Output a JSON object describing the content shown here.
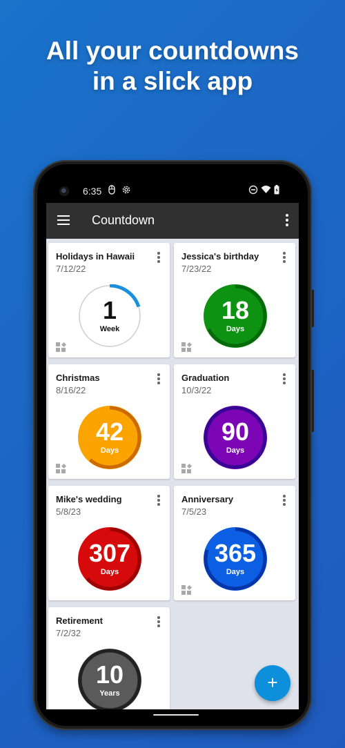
{
  "headline": {
    "line1": "All your countdowns",
    "line2": "in a slick app"
  },
  "statusbar": {
    "time": "6:35",
    "icons": [
      "lens-icon",
      "settings-icon",
      "do-not-disturb-icon",
      "wifi-icon",
      "battery-charging-icon"
    ]
  },
  "appbar": {
    "title": "Countdown",
    "menu_icon": "hamburger-menu-icon",
    "more_icon": "more-vert-icon"
  },
  "cards": [
    {
      "title": "Holidays in Hawaii",
      "date": "7/12/22",
      "value": "1",
      "unit": "Week",
      "progress": 0.2,
      "fill": "#ffffff",
      "ring": "#1a8fdc",
      "track": "#cfcfcf",
      "text_color": "#111111",
      "widget_icon": true
    },
    {
      "title": "Jessica's birthday",
      "date": "7/23/22",
      "value": "18",
      "unit": "Days",
      "progress": 0.66,
      "fill": "#0d9311",
      "ring": "#066a0a",
      "track": "#0d9311",
      "text_color": "#ffffff",
      "widget_icon": true
    },
    {
      "title": "Christmas",
      "date": "8/16/22",
      "value": "42",
      "unit": "Days",
      "progress": 0.6,
      "fill": "#fba400",
      "ring": "#cc6a06",
      "track": "#fba400",
      "text_color": "#ffffff",
      "widget_icon": true
    },
    {
      "title": "Graduation",
      "date": "10/3/22",
      "value": "90",
      "unit": "Days",
      "progress": 1.0,
      "fill": "#7c05b5",
      "ring": "#380694",
      "track": "#7c05b5",
      "text_color": "#ffffff",
      "widget_icon": true
    },
    {
      "title": "Mike's wedding",
      "date": "5/8/23",
      "value": "307",
      "unit": "Days",
      "progress": 0.62,
      "fill": "#d60a0a",
      "ring": "#9c0404",
      "track": "#d60a0a",
      "text_color": "#ffffff",
      "widget_icon": false
    },
    {
      "title": "Anniversary",
      "date": "7/5/23",
      "value": "365",
      "unit": "Days",
      "progress": 0.78,
      "fill": "#0c5ee3",
      "ring": "#0535a8",
      "track": "#0c5ee3",
      "text_color": "#ffffff",
      "widget_icon": true
    },
    {
      "title": "Retirement",
      "date": "7/2/32",
      "value": "10",
      "unit": "Years",
      "progress": 1.0,
      "fill": "#5a5a5a",
      "ring": "#222222",
      "track": "#5a5a5a",
      "text_color": "#ffffff",
      "widget_icon": false
    }
  ],
  "fab": {
    "label": "+",
    "icon": "add-icon"
  }
}
